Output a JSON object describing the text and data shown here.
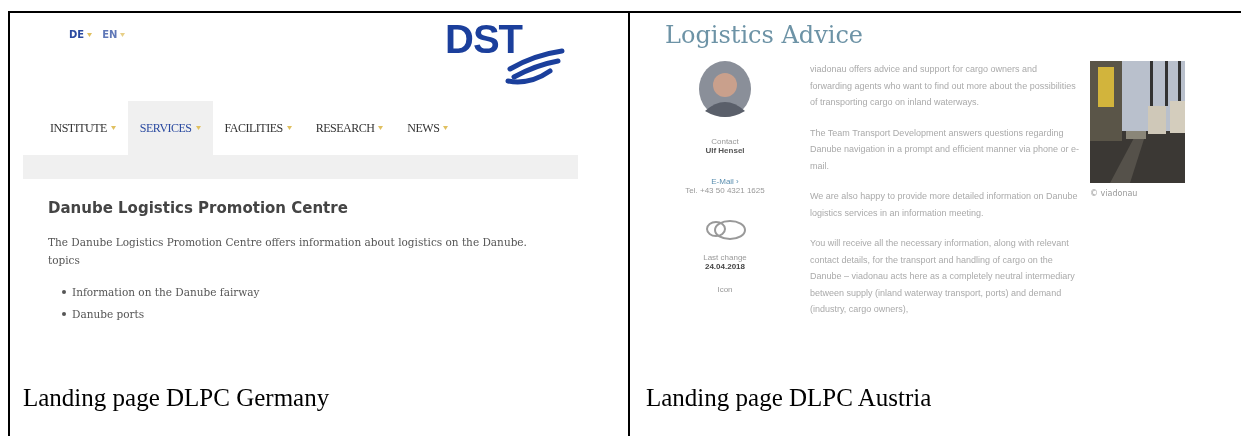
{
  "left_cell": {
    "screenshot": {
      "languages": [
        {
          "label": "DE",
          "selected": true
        },
        {
          "label": "EN",
          "selected": false
        }
      ],
      "logo": "DST",
      "nav": [
        {
          "label": "INSTITUTE",
          "selected": false
        },
        {
          "label": "SERVICES",
          "selected": true
        },
        {
          "label": "FACILITIES",
          "selected": false
        },
        {
          "label": "RESEARCH",
          "selected": false
        },
        {
          "label": "NEWS",
          "selected": false
        }
      ],
      "heading": "Danube Logistics Promotion Centre",
      "paragraph": "The Danube Logistics Promotion Centre offers information about logistics on the Danube.",
      "topics_label": "topics",
      "list": [
        "Information on the Danube fairway",
        "Danube ports"
      ]
    },
    "caption": "Landing page DLPC Germany"
  },
  "right_cell": {
    "screenshot": {
      "heading": "Logistics Advice",
      "contact_label": "Contact",
      "contact_name": "Ulf Hensel",
      "email_link": "E-Mail ›",
      "phone": "Tel. +43 50 4321 1625",
      "last_change_label": "Last change",
      "last_change_date": "24.04.2018",
      "more_label": "Icon",
      "paragraphs": [
        "viadonau offers advice and support for cargo owners and forwarding agents who want to find out more about the possibilities of transporting cargo on inland waterways.",
        "The Team Transport Development answers questions regarding Danube navigation in a prompt and efficient manner via phone or e-mail.",
        "We are also happy to provide more detailed information on Danube logistics services in an information meeting.",
        "You will receive all the necessary information, along with relevant contact details, for the transport and handling of cargo on the Danube – viadonau acts here as a completely neutral intermediary between supply (inland waterway transport, ports) and demand (industry, cargo owners),"
      ],
      "photo": {
        "kind": "picture"
      },
      "photo_credit": "© viadonau"
    },
    "caption": "Landing page DLPC Austria"
  }
}
